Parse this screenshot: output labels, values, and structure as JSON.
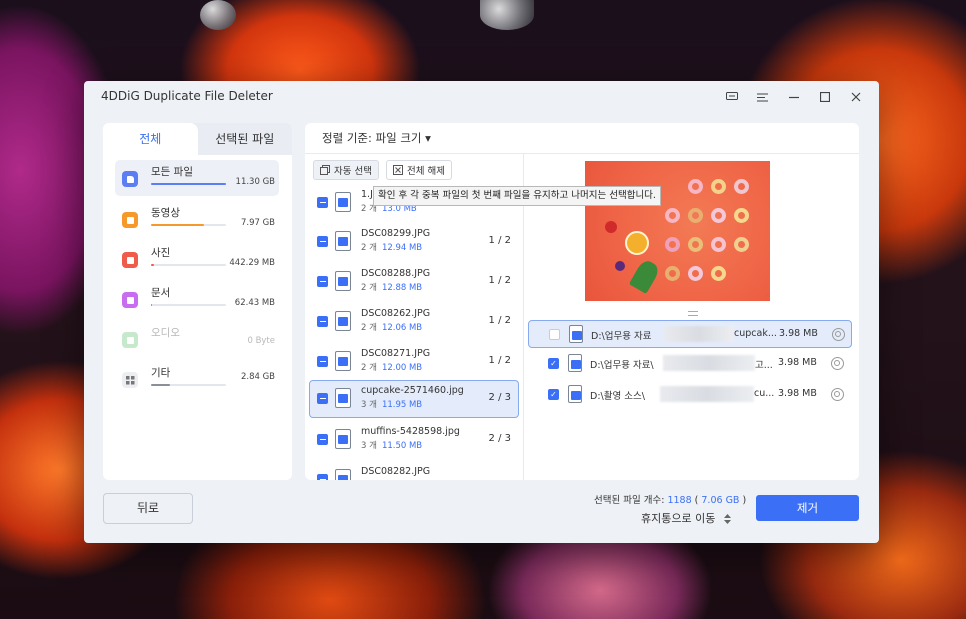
{
  "app": {
    "title": "4DDiG Duplicate File Deleter"
  },
  "left": {
    "tabs": [
      {
        "label": "전체"
      },
      {
        "label": "선택된 파일"
      }
    ],
    "categories": [
      {
        "label": "모든 파일",
        "size": "11.30 GB",
        "color": "#5b7ff2",
        "icon": "all-files-icon"
      },
      {
        "label": "동영상",
        "size": "7.97 GB",
        "color": "#f59a2a",
        "icon": "video-icon"
      },
      {
        "label": "사진",
        "size": "442.29 MB",
        "color": "#ef5d4a",
        "icon": "photo-icon"
      },
      {
        "label": "문서",
        "size": "62.43 MB",
        "color": "#c86cf0",
        "icon": "document-icon"
      },
      {
        "label": "오디오",
        "size": "0 Byte",
        "color": "#8fd09a",
        "icon": "audio-icon"
      },
      {
        "label": "기타",
        "size": "2.84 GB",
        "color": "#8a8f99",
        "icon": "other-icon"
      }
    ],
    "back_label": "뒤로"
  },
  "center": {
    "sort_label": "정렬 기준: 파일 크기 ▾",
    "auto_select_label": "자동 선택",
    "deselect_all_label": "전체 해제",
    "tooltip": "확인 후 각 중복 파일의 첫 번째 파일을 유지하고 나머지는 선택합니다.",
    "groups": [
      {
        "name": "1.J",
        "count": "2 개",
        "size": "13.0 MB",
        "frac": "1 / 2"
      },
      {
        "name": "DSC08299.JPG",
        "count": "2 개",
        "size": "12.94 MB",
        "frac": "1 / 2"
      },
      {
        "name": "DSC08288.JPG",
        "count": "2 개",
        "size": "12.88 MB",
        "frac": "1 / 2"
      },
      {
        "name": "DSC08262.JPG",
        "count": "2 개",
        "size": "12.06 MB",
        "frac": "1 / 2"
      },
      {
        "name": "DSC08271.JPG",
        "count": "2 개",
        "size": "12.00 MB",
        "frac": "1 / 2"
      },
      {
        "name": "cupcake-2571460.jpg",
        "count": "3 개",
        "size": "11.95 MB",
        "frac": "2 / 3"
      },
      {
        "name": "muffins-5428598.jpg",
        "count": "3 개",
        "size": "11.50 MB",
        "frac": "2 / 3"
      },
      {
        "name": "DSC08282.JPG",
        "count": "",
        "size": "",
        "frac": ""
      }
    ],
    "paths": [
      {
        "prefix": "D:\\업무용 자료",
        "tail": "cupcak...",
        "size": "3.98 MB"
      },
      {
        "prefix": "D:\\업무용 자료\\",
        "tail": "고...",
        "size": "3.98 MB"
      },
      {
        "prefix": "D:\\촬영 소스\\",
        "tail": "cu...",
        "size": "3.98 MB"
      }
    ]
  },
  "footer": {
    "selected_prefix": "선택된 파일 개수: ",
    "selected_count": "1188",
    "selected_size": "7.06 GB",
    "move_label": "휴지통으로 이동",
    "remove_label": "제거"
  },
  "colors": {
    "accent": "#3b6ff5"
  }
}
